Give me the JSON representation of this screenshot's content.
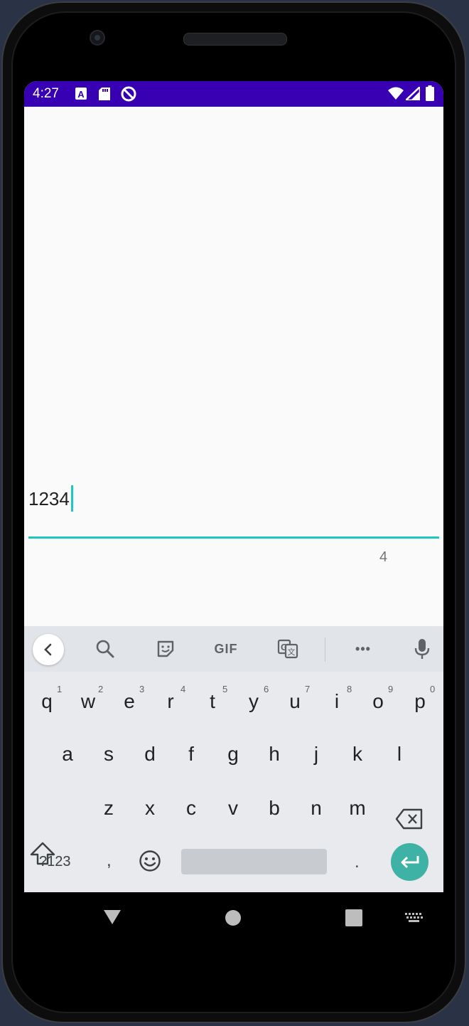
{
  "status_bar": {
    "time": "4:27",
    "icons_left": [
      "font-a-icon",
      "sd-card-icon",
      "do-not-disturb-icon"
    ],
    "icons_right": [
      "wifi-icon",
      "cell-signal-icon",
      "battery-icon"
    ],
    "background": "#3700b3"
  },
  "text_field": {
    "value": "1234",
    "char_count": "4",
    "accent": "#1ec8c0"
  },
  "keyboard": {
    "toolbar": [
      "back-icon",
      "search-icon",
      "sticker-icon",
      "gif-icon",
      "translate-icon",
      "more-icon",
      "mic-icon"
    ],
    "gif_label": "GIF",
    "more_label": "•••",
    "row1": [
      "q",
      "w",
      "e",
      "r",
      "t",
      "y",
      "u",
      "i",
      "o",
      "p"
    ],
    "row1_hints": [
      "1",
      "2",
      "3",
      "4",
      "5",
      "6",
      "7",
      "8",
      "9",
      "0"
    ],
    "row2": [
      "a",
      "s",
      "d",
      "f",
      "g",
      "h",
      "j",
      "k",
      "l"
    ],
    "row3": [
      "z",
      "x",
      "c",
      "v",
      "b",
      "n",
      "m"
    ],
    "symbols_label": "?123",
    "comma_label": ",",
    "period_label": ".",
    "enter_color": "#3fb2a6"
  },
  "nav_bar": {
    "buttons": [
      "back-triangle-icon",
      "home-circle-icon",
      "recents-square-icon",
      "keyboard-switch-icon"
    ]
  }
}
